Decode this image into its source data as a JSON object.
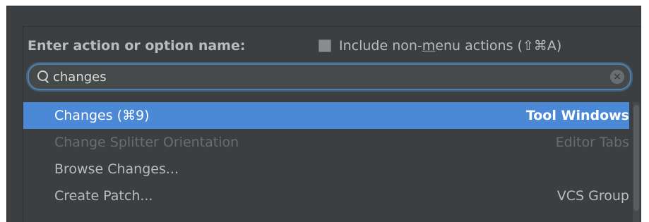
{
  "header": {
    "title": "Enter action or option name:",
    "include_label": "Include non-menu actions (⇧⌘A)",
    "include_checked": false
  },
  "search": {
    "value": "changes",
    "icon": "search-icon",
    "clear_icon": "clear-icon"
  },
  "colors": {
    "background": "#3c3f41",
    "selection": "#4b89d6",
    "focus_ring": "#557fa8",
    "text": "#bbbbbb",
    "disabled_text": "#6a6d70"
  },
  "results": [
    {
      "label": "Changes (⌘9)",
      "group": "Tool Windows",
      "state": "selected"
    },
    {
      "label": "Change Splitter Orientation",
      "group": "Editor Tabs",
      "state": "disabled"
    },
    {
      "label": "Browse Changes...",
      "group": "",
      "state": "normal"
    },
    {
      "label": "Create Patch...",
      "group": "VCS Group",
      "state": "normal"
    }
  ]
}
